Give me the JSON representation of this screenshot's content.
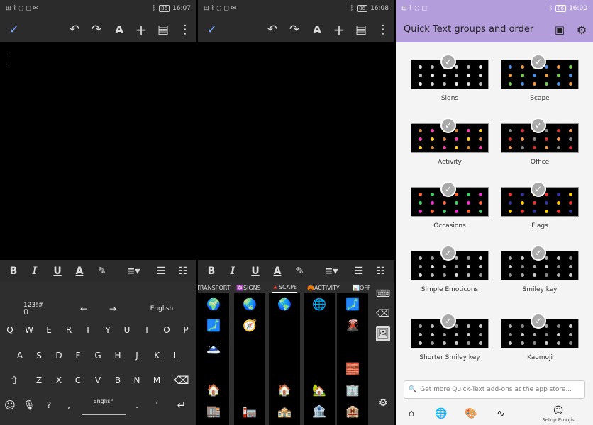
{
  "panel1": {
    "status": {
      "left_icons": "⊞ ⌇ ◌ ◻ ✉",
      "time": "16:07",
      "battery": "86"
    },
    "toolbar": {
      "check_icon": "✓",
      "undo": "↶",
      "redo": "↷",
      "text_format": "A",
      "insert": "+",
      "comment": "▤",
      "more": "⋮"
    },
    "format": {
      "bold": "B",
      "italic": "I",
      "underline": "U",
      "text_color": "A",
      "highlight": "✎",
      "align": "≡▾",
      "bullets": "☰",
      "numbered": "☷"
    },
    "keyboard": {
      "row0": [
        "123!#()",
        "←",
        "→",
        "English"
      ],
      "row1": [
        "Q",
        "W",
        "E",
        "R",
        "T",
        "Y",
        "U",
        "I",
        "O",
        "P"
      ],
      "row2": [
        "A",
        "S",
        "D",
        "F",
        "G",
        "H",
        "J",
        "K",
        "L"
      ],
      "row3": [
        "⇧",
        "Z",
        "X",
        "C",
        "V",
        "B",
        "N",
        "M",
        "⌫"
      ],
      "row4": [
        "☺",
        "🎙",
        "?",
        ",",
        "English",
        ".",
        "'",
        "↵"
      ]
    }
  },
  "panel2": {
    "status": {
      "left_icons": "⊞ ⌇ ◌ ◻ ✉",
      "time": "16:08",
      "battery": "86"
    },
    "tabs": [
      "TRANSPORT",
      "SIGNS",
      "SCAPE",
      "ACTIVITY",
      "OFF"
    ],
    "tab_icons": [
      "",
      "🔯",
      "🔺",
      "🎃",
      "📊"
    ],
    "emojis": [
      [
        "🌍",
        "🌏",
        "🌎",
        "🌐",
        "🗾"
      ],
      [
        "🗾",
        "🧭",
        "🏔",
        "⛰",
        "🌋"
      ],
      [
        "🗻",
        "🏕",
        "🏖",
        "🏜",
        "🏝"
      ],
      [
        "🏞",
        "🏟",
        "🏛",
        "🏗",
        "🧱"
      ],
      [
        "🏠",
        "🏚",
        "🏠",
        "🏡",
        "🏢"
      ],
      [
        "🏬",
        "🏣",
        "🏤",
        "🏦",
        "🏨"
      ]
    ],
    "side": [
      "⌨",
      "⌫",
      "🖼",
      "⚙"
    ]
  },
  "panel3": {
    "status": {
      "left_icons": "⊞ ⌇ ◌ ◻",
      "time": "16:00",
      "battery": "86"
    },
    "title": "Quick Text groups and order",
    "tiles": [
      "Signs",
      "Scape",
      "Activity",
      "Office",
      "Occasions",
      "Flags",
      "Simple Emoticons",
      "Smiley key",
      "Shorter Smiley key",
      "Kaomoji"
    ],
    "search_placeholder": "Get more Quick-Text add-ons at the app store...",
    "nav": {
      "home": "⌂",
      "globe": "🌐",
      "palette": "🎨",
      "gesture": "∿",
      "emoji": "☺",
      "emoji_label": "Setup Emojis"
    }
  }
}
